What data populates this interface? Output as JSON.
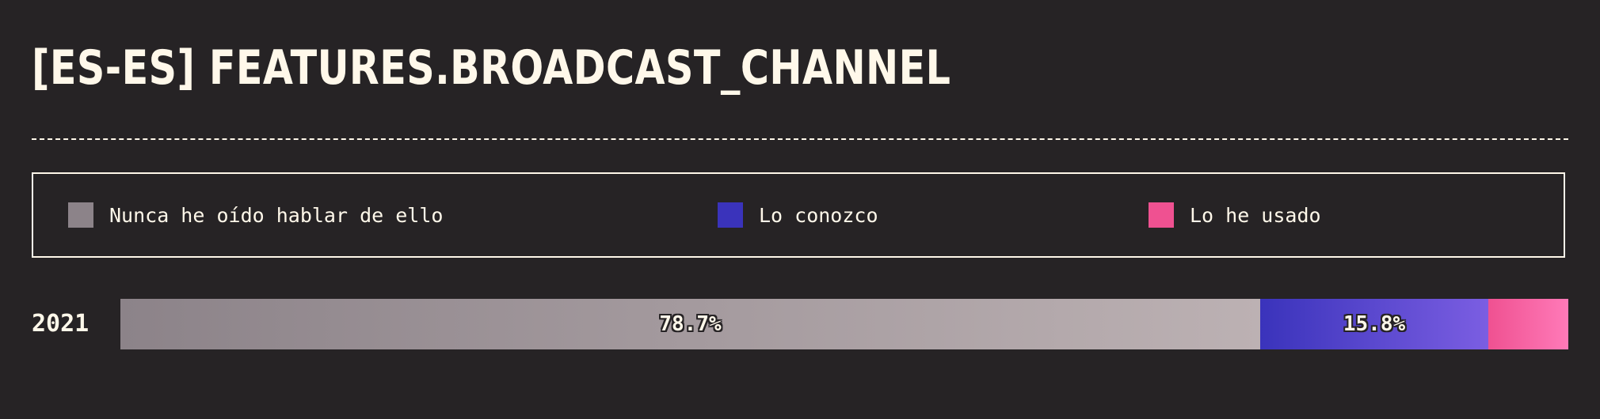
{
  "title": "[ES-ES] FEATURES.BROADCAST_CHANNEL",
  "legend": [
    {
      "label": "Nunca he oído hablar de ello",
      "color": "#8c8389"
    },
    {
      "label": "Lo conozco",
      "color": "#3a33bb"
    },
    {
      "label": "Lo he usado",
      "color": "#ef5191"
    }
  ],
  "chart_data": {
    "type": "bar",
    "orientation": "horizontal",
    "stacked": true,
    "normalized_percent": true,
    "title": "[ES-ES] FEATURES.BROADCAST_CHANNEL",
    "categories": [
      "2021"
    ],
    "series": [
      {
        "name": "Nunca he oído hablar de ello",
        "values": [
          78.7
        ],
        "label": "78.7%",
        "color_start": "#8c8389",
        "color_end": "#bcb1b3"
      },
      {
        "name": "Lo conozco",
        "values": [
          15.8
        ],
        "label": "15.8%",
        "color_start": "#3a33bb",
        "color_end": "#7b5ee2"
      },
      {
        "name": "Lo he usado",
        "values": [
          5.5
        ],
        "label": "",
        "color_start": "#ef5191",
        "color_end": "#ff7ab8"
      }
    ],
    "legend_position": "top",
    "xlim": [
      0,
      100
    ]
  }
}
